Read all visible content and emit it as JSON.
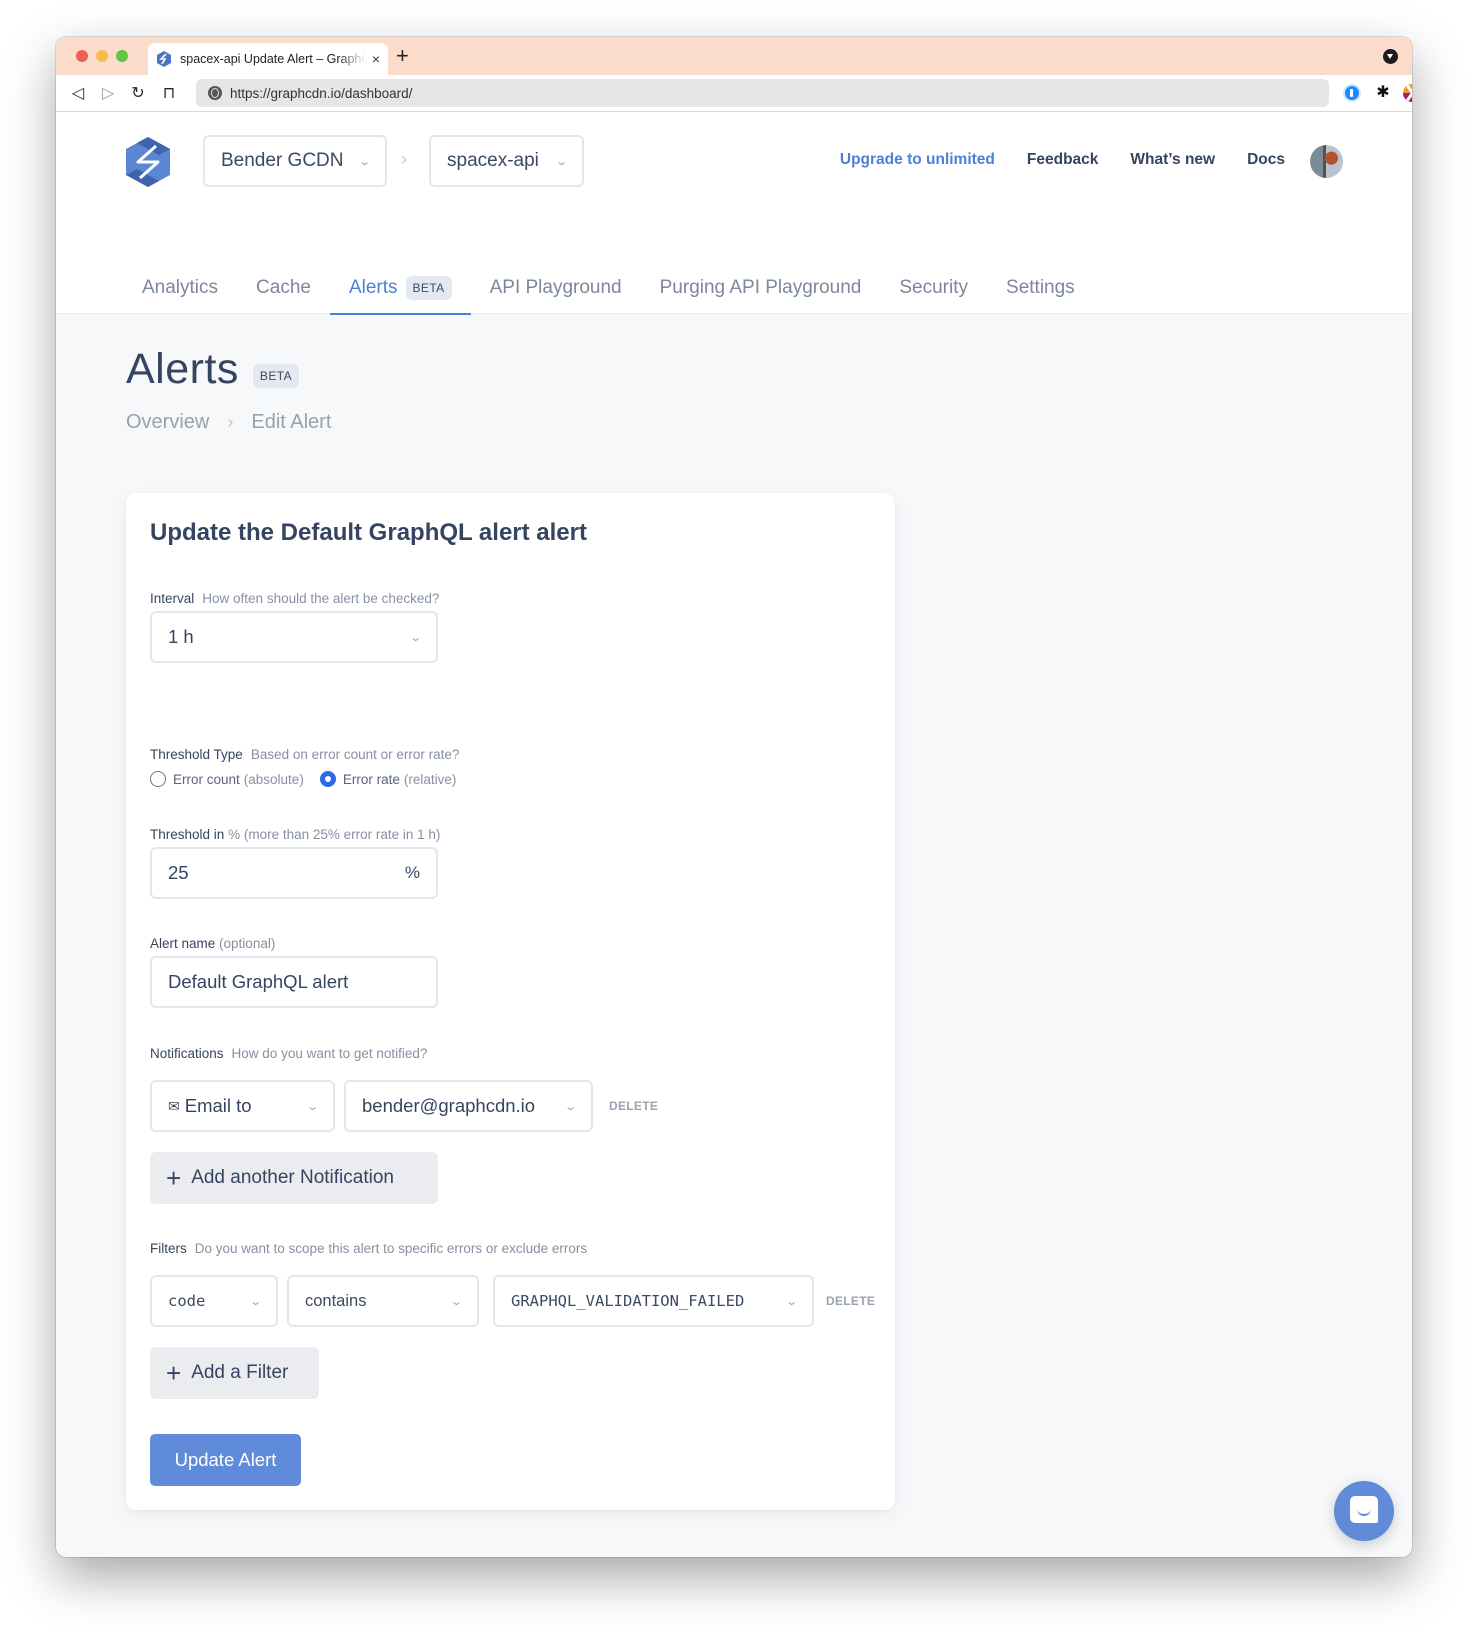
{
  "browser": {
    "tab_title": "spacex-api Update Alert – GraphCDN",
    "url": "https://graphcdn.io/dashboard/",
    "new_tab_label": "+",
    "tab_close_label": "×"
  },
  "header": {
    "org": "Bender GCDN",
    "project": "spacex-api",
    "links": {
      "upgrade": "Upgrade to unlimited",
      "feedback": "Feedback",
      "whats_new": "What’s new",
      "docs": "Docs"
    }
  },
  "nav": {
    "tabs": [
      {
        "label": "Analytics"
      },
      {
        "label": "Cache"
      },
      {
        "label": "Alerts",
        "badge": "BETA",
        "active": true
      },
      {
        "label": "API Playground"
      },
      {
        "label": "Purging API Playground"
      },
      {
        "label": "Security"
      },
      {
        "label": "Settings"
      }
    ]
  },
  "page": {
    "title": "Alerts",
    "badge": "BETA",
    "breadcrumb": [
      "Overview",
      "Edit Alert"
    ]
  },
  "form": {
    "title": "Update the Default GraphQL alert alert",
    "interval": {
      "label": "Interval",
      "hint": "How often should the alert be checked?",
      "value": "1 h"
    },
    "threshold_type": {
      "label": "Threshold Type",
      "hint": "Based on error count or error rate?",
      "options": [
        {
          "label": "Error count",
          "detail": "(absolute)",
          "checked": false
        },
        {
          "label": "Error rate",
          "detail": "(relative)",
          "checked": true
        }
      ]
    },
    "threshold": {
      "label": "Threshold in",
      "unit_hint": "%",
      "hint": "(more than 25% error rate in 1 h)",
      "value": "25",
      "suffix": "%"
    },
    "alert_name": {
      "label": "Alert name",
      "hint": "(optional)",
      "value": "Default GraphQL alert"
    },
    "notifications": {
      "label": "Notifications",
      "hint": "How do you want to get notified?",
      "items": [
        {
          "type": "Email to",
          "target": "bender@graphcdn.io",
          "delete_label": "DELETE"
        }
      ],
      "add_label": "Add another Notification"
    },
    "filters": {
      "label": "Filters",
      "hint": "Do you want to scope this alert to specific errors or exclude errors",
      "items": [
        {
          "field": "code",
          "operator": "contains",
          "value": "GRAPHQL_VALIDATION_FAILED",
          "delete_label": "DELETE"
        }
      ],
      "add_label": "Add a Filter"
    },
    "submit_label": "Update Alert"
  },
  "colors": {
    "accent": "#4e7fd6",
    "primary_button": "#608bdb",
    "radio_checked": "#2d6ae3",
    "text": "#354561",
    "tabbar": "#fbdccb"
  }
}
